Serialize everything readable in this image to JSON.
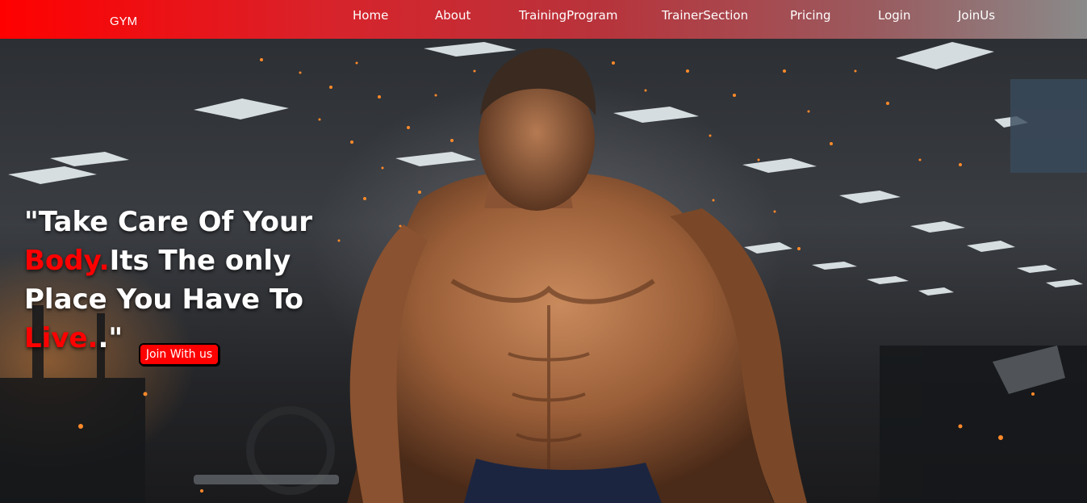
{
  "navbar": {
    "logo": "GYM",
    "links": [
      {
        "label": "Home"
      },
      {
        "label": "About"
      },
      {
        "label": "TrainingProgram"
      },
      {
        "label": "TrainerSection"
      },
      {
        "label": "Pricing"
      },
      {
        "label": "Login"
      },
      {
        "label": "JoinUs"
      }
    ]
  },
  "hero": {
    "quote": {
      "part1": "\"Take Care Of Your ",
      "highlight1": "Body.",
      "part2": "Its The only Place You Have To ",
      "highlight2": "Live.",
      "part3": ".\""
    },
    "cta_label": "Join With us",
    "image_subject": "muscular-man-in-gym"
  },
  "colors": {
    "accent": "#ff0000",
    "nav_gradient_start": "#ff0000",
    "nav_gradient_end": "#8a8a8a",
    "text": "#ffffff"
  }
}
